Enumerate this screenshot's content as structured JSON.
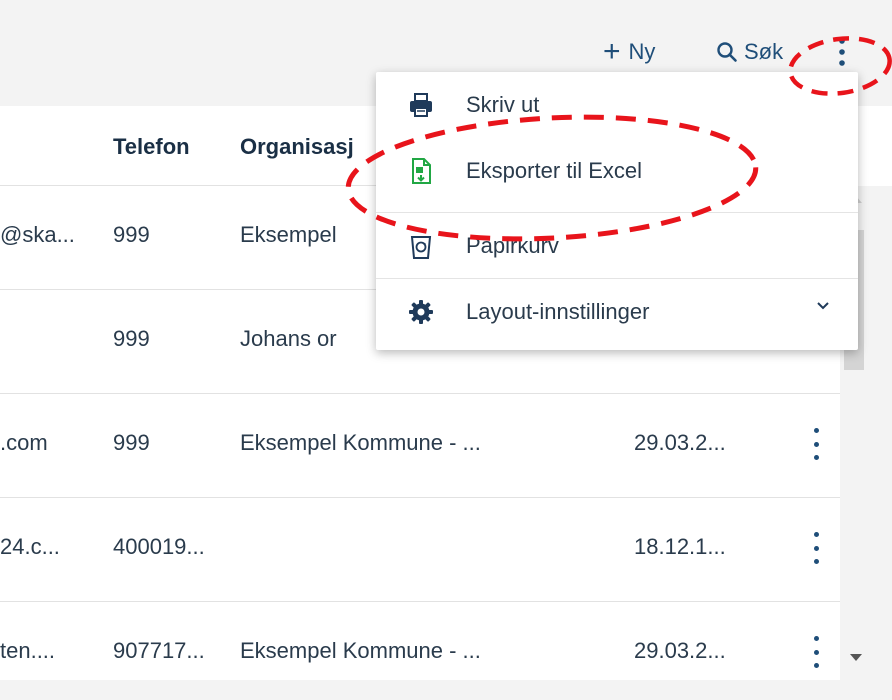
{
  "toolbar": {
    "new_label": "Ny",
    "search_label": "Søk"
  },
  "table": {
    "columns": [
      "Telefon",
      "Organisasj"
    ],
    "rows": [
      {
        "email": "@ska...",
        "phone": "999",
        "org": "Eksempel",
        "date": ""
      },
      {
        "email": "",
        "phone": "999",
        "org": "Johans or",
        "date": ""
      },
      {
        "email": ".com",
        "phone": "999",
        "org": "Eksempel Kommune - ...",
        "date": "29.03.2..."
      },
      {
        "email": "24.c...",
        "phone": "400019...",
        "org": "",
        "date": "18.12.1..."
      },
      {
        "email": "ten....",
        "phone": "907717...",
        "org": "Eksempel Kommune - ...",
        "date": "29.03.2..."
      }
    ]
  },
  "menu": {
    "items": [
      {
        "label": "Skriv ut",
        "icon": "printer-icon"
      },
      {
        "label": "Eksporter til Excel",
        "icon": "excel-export-icon"
      },
      {
        "label": "Papirkurv",
        "icon": "recycle-bin-icon"
      },
      {
        "label": "Layout-innstillinger",
        "icon": "gear-icon"
      }
    ]
  },
  "colors": {
    "accent": "#1f4e79",
    "annotation": "#e8141b",
    "excel_green": "#21a744"
  }
}
